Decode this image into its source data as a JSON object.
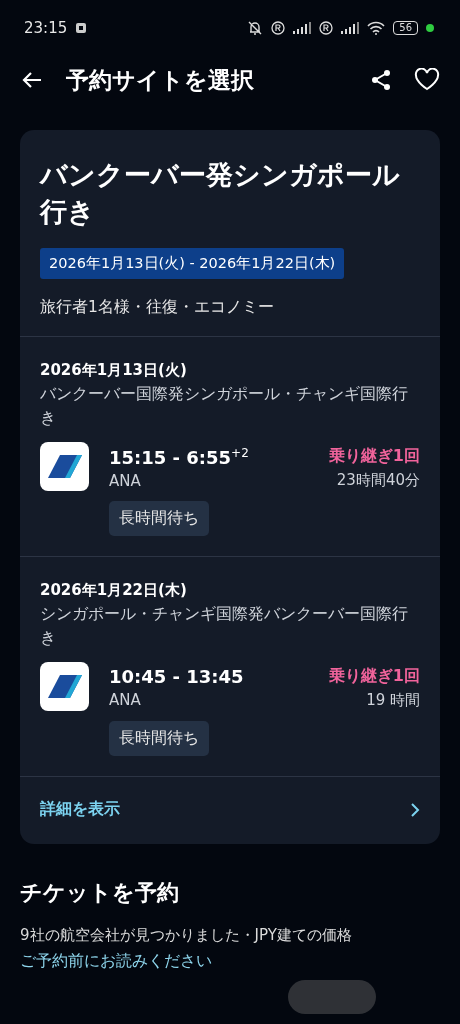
{
  "status_bar": {
    "time": "23:15",
    "battery": "56"
  },
  "header": {
    "title": "予約サイトを選択"
  },
  "trip": {
    "title": "バンクーバー発シンガポール行き",
    "dates": "2026年1月13日(火) - 2026年1月22日(木)",
    "travelers": "旅行者1名様・往復・エコノミー",
    "legs": [
      {
        "date": "2026年1月13日(火)",
        "route": "バンクーバー国際発シンガポール・チャンギ国際行き",
        "times": "15:15 - 6:55",
        "plus_days": "+2",
        "airline": "ANA",
        "stops": "乗り継ぎ1回",
        "duration": "23時間40分",
        "tag": "長時間待ち"
      },
      {
        "date": "2026年1月22日(木)",
        "route": "シンガポール・チャンギ国際発バンクーバー国際行き",
        "times": "10:45 - 13:45",
        "airline": "ANA",
        "stops": "乗り継ぎ1回",
        "duration": "19 時間",
        "tag": "長時間待ち"
      }
    ],
    "details_link": "詳細を表示"
  },
  "booking": {
    "title": "チケットを予約",
    "subtitle": "9社の航空会社が見つかりました・JPY建ての価格",
    "note_link": "ご予約前にお読みください"
  }
}
